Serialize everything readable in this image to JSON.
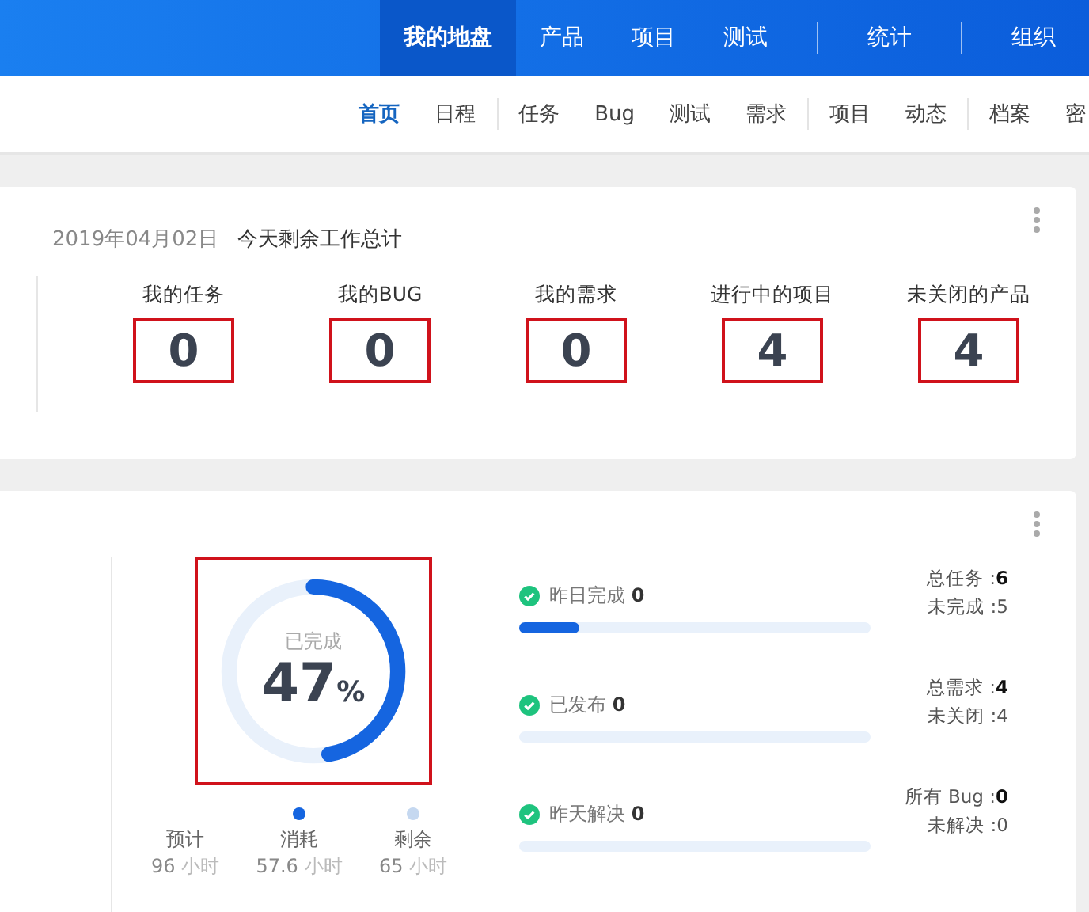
{
  "top_nav": {
    "groups": [
      [
        {
          "label": "我的地盘",
          "selected": true
        },
        {
          "label": "产品",
          "selected": false
        },
        {
          "label": "项目",
          "selected": false
        },
        {
          "label": "测试",
          "selected": false
        }
      ],
      [
        {
          "label": "统计",
          "selected": false
        }
      ],
      [
        {
          "label": "组织",
          "selected": false
        }
      ]
    ]
  },
  "sub_nav": {
    "groups": [
      [
        {
          "label": "首页",
          "selected": true
        },
        {
          "label": "日程",
          "selected": false
        }
      ],
      [
        {
          "label": "任务",
          "selected": false
        },
        {
          "label": "Bug",
          "selected": false
        },
        {
          "label": "测试",
          "selected": false
        },
        {
          "label": "需求",
          "selected": false
        }
      ],
      [
        {
          "label": "项目",
          "selected": false
        },
        {
          "label": "动态",
          "selected": false
        }
      ],
      [
        {
          "label": "档案",
          "selected": false
        },
        {
          "label": "密",
          "selected": false
        }
      ]
    ]
  },
  "summary": {
    "date": "2019年04月02日",
    "title": "今天剩余工作总计",
    "stats": [
      {
        "label": "我的任务",
        "value": "0",
        "highlighted": true
      },
      {
        "label": "我的BUG",
        "value": "0",
        "highlighted": true
      },
      {
        "label": "我的需求",
        "value": "0",
        "highlighted": true
      },
      {
        "label": "进行中的项目",
        "value": "4",
        "highlighted": true
      },
      {
        "label": "未关闭的产品",
        "value": "4",
        "highlighted": true
      }
    ]
  },
  "progress": {
    "donut": {
      "caption": "已完成",
      "value": "47",
      "unit": "%",
      "level": 0.47,
      "highlighted": true
    },
    "legend": [
      {
        "label": "预计",
        "value": "96",
        "unit": "小时"
      },
      {
        "label": "消耗",
        "value": "57.6",
        "unit": "小时",
        "color": "#1565e0"
      },
      {
        "label": "剩余",
        "value": "65",
        "unit": "小时",
        "color": "#c5d8f0"
      }
    ],
    "rows": [
      {
        "label": "昨日完成",
        "count": "0",
        "level": 0.17,
        "totals": [
          {
            "label": "总任务 :",
            "value": "6",
            "bold": true
          },
          {
            "label": "未完成 :",
            "value": "5",
            "bold": false
          }
        ]
      },
      {
        "label": "已发布",
        "count": "0",
        "totals": [
          {
            "label": "总需求 :",
            "value": "4",
            "bold": true
          },
          {
            "label": "未关闭 :",
            "value": "4",
            "bold": false
          }
        ]
      },
      {
        "label": "昨天解决",
        "count": "0",
        "totals": [
          {
            "label": "所有 Bug :",
            "value": "0",
            "bold": true
          },
          {
            "label": "未解决 :",
            "value": "0",
            "bold": false
          }
        ]
      }
    ]
  }
}
